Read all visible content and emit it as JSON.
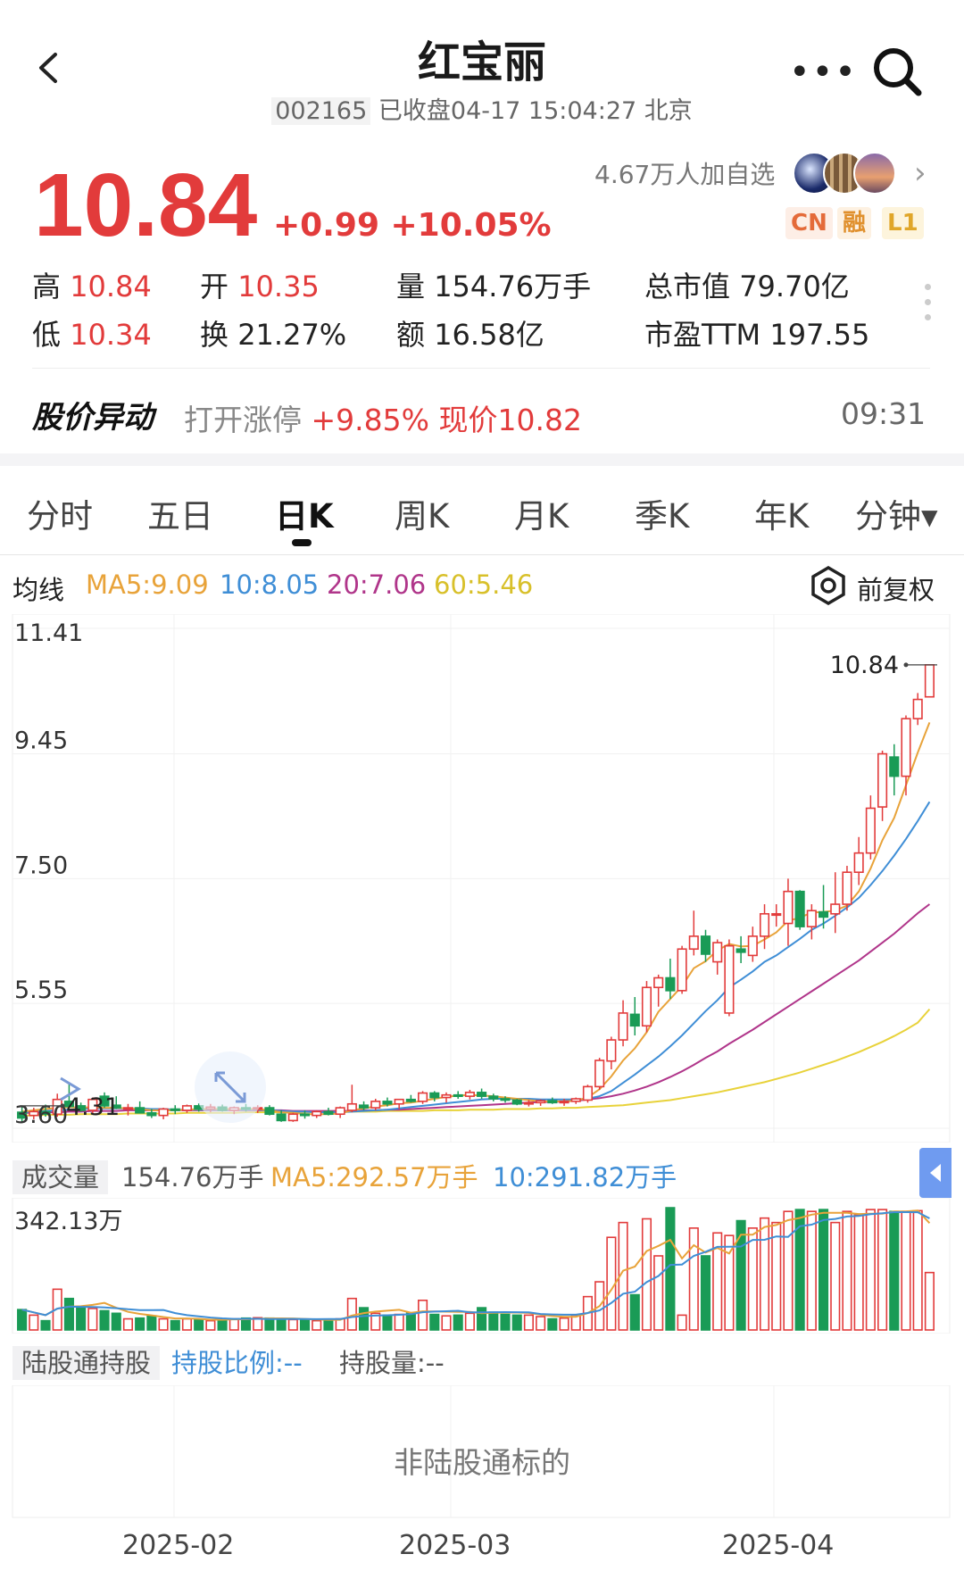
{
  "header": {
    "title": "红宝丽",
    "code": "002165",
    "status": "已收盘04-17 15:04:27 北京"
  },
  "quote": {
    "price": "10.84",
    "change": "+0.99 +10.05%",
    "follow": "4.67万人加自选",
    "badges": [
      "CN",
      "融",
      "L1"
    ]
  },
  "stats": {
    "high_label": "高",
    "high": "10.84",
    "low_label": "低",
    "low": "10.34",
    "open_label": "开",
    "open": "10.35",
    "turnover_label": "换",
    "turnover": "21.27%",
    "volume_label": "量",
    "volume": "154.76万手",
    "amount_label": "额",
    "amount": "16.58亿",
    "mktcap_label": "总市值",
    "mktcap": "79.70亿",
    "pe_label": "市盈TTM",
    "pe": "197.55"
  },
  "alert": {
    "title": "股价异动",
    "prefix": "打开涨停",
    "detail": "+9.85% 现价10.82",
    "time": "09:31"
  },
  "tabs": [
    "分时",
    "五日",
    "日K",
    "周K",
    "月K",
    "季K",
    "年K",
    "分钟▾"
  ],
  "active_tab": "日K",
  "ma": {
    "label": "均线",
    "ma5": "MA5:9.09",
    "ma10": "10:8.05",
    "ma20": "20:7.06",
    "ma60": "60:5.46",
    "colors": {
      "ma5": "#e8a33a",
      "ma10": "#3f8ed6",
      "ma20": "#b0358a",
      "ma60": "#e8d23a"
    },
    "adjust": "前复权"
  },
  "volume_panel": {
    "label": "成交量",
    "value": "154.76万手",
    "ma5": "MA5:292.57万手",
    "ma10": "10:291.82万手",
    "max_label": "342.13万"
  },
  "hk_panel": {
    "label": "陆股通持股",
    "ratio": "持股比例:--",
    "amount": "持股量:--",
    "note": "非陆股通标的"
  },
  "chart_data": {
    "type": "candlestick",
    "y_ticks": [
      "11.41",
      "9.45",
      "7.50",
      "5.55",
      "3.60"
    ],
    "ylim": [
      3.6,
      11.41
    ],
    "x_ticks": [
      "2025-02",
      "2025-03",
      "2025-04"
    ],
    "high_marker": "10.84",
    "low_marker": "4.31",
    "colors": {
      "up": "#e23b3b",
      "down": "#1a9b56"
    },
    "candles": [
      [
        3.85,
        3.95,
        3.7,
        3.76
      ],
      [
        3.8,
        3.92,
        3.74,
        3.86
      ],
      [
        3.86,
        3.97,
        3.78,
        3.82
      ],
      [
        3.82,
        4.14,
        3.78,
        4.05
      ],
      [
        4.02,
        4.31,
        3.94,
        3.94
      ],
      [
        3.95,
        4.0,
        3.86,
        3.88
      ],
      [
        3.88,
        4.08,
        3.82,
        4.05
      ],
      [
        4.1,
        4.16,
        3.92,
        3.95
      ],
      [
        3.96,
        4.1,
        3.9,
        3.92
      ],
      [
        3.9,
        3.98,
        3.8,
        3.92
      ],
      [
        3.92,
        4.02,
        3.84,
        3.84
      ],
      [
        3.84,
        3.9,
        3.76,
        3.8
      ],
      [
        3.8,
        3.92,
        3.74,
        3.9
      ],
      [
        3.9,
        3.96,
        3.82,
        3.88
      ],
      [
        3.88,
        3.97,
        3.84,
        3.95
      ],
      [
        3.95,
        3.99,
        3.86,
        3.9
      ],
      [
        3.9,
        3.98,
        3.85,
        3.93
      ],
      [
        3.93,
        3.97,
        3.86,
        3.88
      ],
      [
        3.88,
        3.94,
        3.82,
        3.92
      ],
      [
        3.92,
        3.98,
        3.86,
        3.9
      ],
      [
        3.9,
        3.96,
        3.84,
        3.92
      ],
      [
        3.92,
        3.96,
        3.8,
        3.82
      ],
      [
        3.82,
        3.88,
        3.7,
        3.72
      ],
      [
        3.72,
        3.84,
        3.7,
        3.82
      ],
      [
        3.82,
        3.88,
        3.75,
        3.8
      ],
      [
        3.8,
        3.88,
        3.76,
        3.86
      ],
      [
        3.86,
        3.92,
        3.8,
        3.82
      ],
      [
        3.82,
        3.94,
        3.76,
        3.92
      ],
      [
        3.88,
        4.28,
        3.85,
        3.98
      ],
      [
        3.96,
        4.02,
        3.88,
        3.92
      ],
      [
        3.92,
        4.06,
        3.88,
        4.02
      ],
      [
        4.02,
        4.08,
        3.94,
        3.98
      ],
      [
        3.98,
        4.06,
        3.9,
        4.05
      ],
      [
        4.05,
        4.12,
        4.0,
        4.02
      ],
      [
        4.02,
        4.18,
        3.98,
        4.15
      ],
      [
        4.15,
        4.18,
        4.02,
        4.08
      ],
      [
        4.08,
        4.16,
        4.0,
        4.12
      ],
      [
        4.12,
        4.18,
        4.06,
        4.1
      ],
      [
        4.1,
        4.2,
        4.05,
        4.16
      ],
      [
        4.16,
        4.22,
        4.06,
        4.1
      ],
      [
        4.1,
        4.14,
        4.02,
        4.06
      ],
      [
        4.06,
        4.1,
        4.0,
        4.04
      ],
      [
        4.04,
        4.06,
        3.96,
        3.98
      ],
      [
        3.98,
        4.04,
        3.94,
        4.0
      ],
      [
        4.0,
        4.05,
        3.95,
        4.03
      ],
      [
        4.03,
        4.08,
        3.98,
        4.0
      ],
      [
        4.0,
        4.06,
        3.95,
        4.02
      ],
      [
        4.02,
        4.08,
        3.98,
        4.06
      ],
      [
        4.04,
        4.28,
        4.0,
        4.25
      ],
      [
        4.25,
        4.7,
        4.2,
        4.66
      ],
      [
        4.65,
        5.03,
        4.52,
        4.98
      ],
      [
        4.98,
        5.6,
        4.88,
        5.4
      ],
      [
        5.38,
        5.65,
        5.05,
        5.2
      ],
      [
        5.2,
        5.9,
        5.1,
        5.8
      ],
      [
        5.8,
        6.0,
        5.5,
        5.95
      ],
      [
        5.95,
        6.25,
        5.62,
        5.75
      ],
      [
        5.75,
        6.45,
        5.7,
        6.4
      ],
      [
        6.4,
        7.0,
        6.3,
        6.6
      ],
      [
        6.6,
        6.7,
        6.2,
        6.32
      ],
      [
        6.2,
        6.55,
        6.0,
        6.5
      ],
      [
        5.4,
        6.55,
        5.35,
        6.45
      ],
      [
        6.4,
        6.6,
        6.18,
        6.35
      ],
      [
        6.3,
        6.75,
        6.2,
        6.6
      ],
      [
        6.6,
        7.1,
        6.4,
        6.95
      ],
      [
        6.95,
        7.1,
        6.75,
        6.95
      ],
      [
        6.8,
        7.5,
        6.45,
        7.3
      ],
      [
        7.3,
        7.32,
        6.7,
        6.75
      ],
      [
        6.75,
        7.1,
        6.55,
        7.0
      ],
      [
        6.98,
        7.4,
        6.72,
        6.9
      ],
      [
        6.95,
        7.6,
        6.65,
        7.1
      ],
      [
        7.1,
        7.7,
        7.0,
        7.6
      ],
      [
        7.6,
        8.15,
        7.4,
        7.9
      ],
      [
        7.9,
        8.8,
        7.8,
        8.6
      ],
      [
        8.62,
        9.5,
        8.4,
        9.45
      ],
      [
        9.4,
        9.6,
        8.8,
        9.1
      ],
      [
        9.1,
        10.05,
        8.8,
        10.0
      ],
      [
        10.0,
        10.4,
        9.9,
        10.3
      ],
      [
        10.34,
        10.84,
        10.34,
        10.84
      ]
    ],
    "ma5": [
      3.86,
      3.88,
      3.9,
      3.92,
      3.93,
      3.92,
      3.93,
      3.92,
      3.92,
      3.91,
      3.9,
      3.88,
      3.88,
      3.88,
      3.89,
      3.9,
      3.9,
      3.9,
      3.9,
      3.9,
      3.9,
      3.88,
      3.85,
      3.84,
      3.82,
      3.82,
      3.82,
      3.83,
      3.88,
      3.91,
      3.94,
      3.96,
      3.99,
      4.0,
      4.03,
      4.06,
      4.09,
      4.11,
      4.12,
      4.11,
      4.1,
      4.08,
      4.06,
      4.04,
      4.02,
      4.02,
      4.02,
      4.03,
      4.08,
      4.21,
      4.41,
      4.66,
      4.85,
      5.1,
      5.42,
      5.62,
      5.82,
      6.1,
      6.21,
      6.38,
      6.48,
      6.44,
      6.45,
      6.55,
      6.66,
      6.84,
      6.89,
      6.97,
      6.98,
      7.0,
      7.08,
      7.3,
      7.66,
      8.1,
      8.45,
      8.96,
      9.47,
      9.94
    ],
    "ma10": [
      3.85,
      3.86,
      3.87,
      3.88,
      3.89,
      3.9,
      3.91,
      3.91,
      3.91,
      3.91,
      3.91,
      3.9,
      3.9,
      3.89,
      3.89,
      3.89,
      3.89,
      3.89,
      3.89,
      3.89,
      3.89,
      3.88,
      3.87,
      3.86,
      3.86,
      3.85,
      3.85,
      3.85,
      3.86,
      3.87,
      3.88,
      3.89,
      3.91,
      3.93,
      3.95,
      3.97,
      3.99,
      4.01,
      4.03,
      4.05,
      4.06,
      4.06,
      4.06,
      4.06,
      4.05,
      4.05,
      4.05,
      4.05,
      4.06,
      4.1,
      4.18,
      4.31,
      4.44,
      4.58,
      4.72,
      4.88,
      5.05,
      5.24,
      5.43,
      5.6,
      5.8,
      5.92,
      6.05,
      6.2,
      6.3,
      6.43,
      6.56,
      6.7,
      6.8,
      6.92,
      7.05,
      7.2,
      7.4,
      7.62,
      7.86,
      8.12,
      8.4,
      8.7
    ],
    "ma20": [
      3.84,
      3.84,
      3.85,
      3.85,
      3.86,
      3.86,
      3.87,
      3.87,
      3.87,
      3.88,
      3.88,
      3.88,
      3.88,
      3.88,
      3.88,
      3.88,
      3.88,
      3.88,
      3.88,
      3.88,
      3.88,
      3.88,
      3.88,
      3.87,
      3.87,
      3.87,
      3.87,
      3.87,
      3.87,
      3.88,
      3.88,
      3.89,
      3.89,
      3.9,
      3.91,
      3.92,
      3.93,
      3.94,
      3.95,
      3.96,
      3.97,
      3.98,
      3.99,
      4.0,
      4.01,
      4.01,
      4.02,
      4.03,
      4.05,
      4.07,
      4.1,
      4.14,
      4.19,
      4.25,
      4.32,
      4.4,
      4.49,
      4.59,
      4.7,
      4.8,
      4.92,
      5.03,
      5.14,
      5.26,
      5.38,
      5.5,
      5.62,
      5.74,
      5.86,
      5.98,
      6.1,
      6.22,
      6.36,
      6.5,
      6.64,
      6.8,
      6.96,
      7.1
    ],
    "ma60": [
      3.8,
      3.8,
      3.81,
      3.81,
      3.81,
      3.82,
      3.82,
      3.82,
      3.82,
      3.83,
      3.83,
      3.83,
      3.83,
      3.83,
      3.84,
      3.84,
      3.84,
      3.84,
      3.84,
      3.85,
      3.85,
      3.85,
      3.85,
      3.85,
      3.85,
      3.85,
      3.86,
      3.86,
      3.86,
      3.86,
      3.86,
      3.87,
      3.87,
      3.87,
      3.87,
      3.88,
      3.88,
      3.88,
      3.89,
      3.89,
      3.89,
      3.9,
      3.9,
      3.9,
      3.91,
      3.91,
      3.92,
      3.92,
      3.93,
      3.94,
      3.95,
      3.96,
      3.98,
      4.0,
      4.02,
      4.04,
      4.07,
      4.1,
      4.13,
      4.16,
      4.2,
      4.24,
      4.28,
      4.32,
      4.37,
      4.42,
      4.47,
      4.53,
      4.59,
      4.65,
      4.72,
      4.79,
      4.87,
      4.95,
      5.04,
      5.14,
      5.25,
      5.46
    ],
    "volumes": [
      55,
      40,
      25,
      110,
      85,
      60,
      58,
      52,
      45,
      30,
      32,
      38,
      30,
      25,
      30,
      28,
      25,
      30,
      30,
      32,
      33,
      32,
      30,
      28,
      26,
      25,
      28,
      30,
      85,
      60,
      45,
      40,
      42,
      45,
      80,
      42,
      38,
      40,
      45,
      60,
      48,
      42,
      40,
      40,
      36,
      30,
      32,
      40,
      90,
      130,
      250,
      290,
      95,
      300,
      200,
      330,
      40,
      275,
      200,
      262,
      255,
      295,
      275,
      302,
      290,
      320,
      325,
      320,
      325,
      290,
      320,
      310,
      325,
      325,
      320,
      320,
      322,
      155
    ],
    "vol_ymax": 342.13
  }
}
